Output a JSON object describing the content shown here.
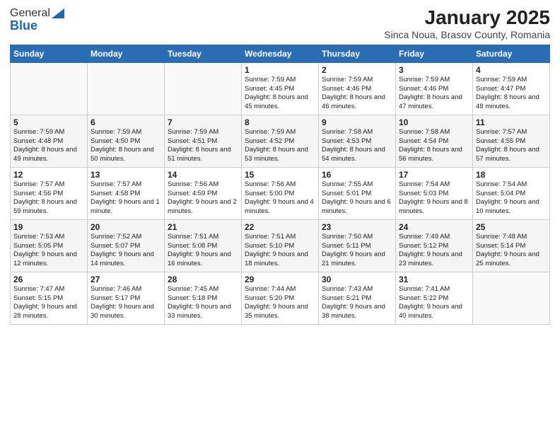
{
  "header": {
    "logo_general": "General",
    "logo_blue": "Blue",
    "title": "January 2025",
    "subtitle": "Sinca Noua, Brasov County, Romania"
  },
  "days_of_week": [
    "Sunday",
    "Monday",
    "Tuesday",
    "Wednesday",
    "Thursday",
    "Friday",
    "Saturday"
  ],
  "weeks": [
    [
      {
        "day": "",
        "info": ""
      },
      {
        "day": "",
        "info": ""
      },
      {
        "day": "",
        "info": ""
      },
      {
        "day": "1",
        "info": "Sunrise: 7:59 AM\nSunset: 4:45 PM\nDaylight: 8 hours and 45 minutes."
      },
      {
        "day": "2",
        "info": "Sunrise: 7:59 AM\nSunset: 4:46 PM\nDaylight: 8 hours and 46 minutes."
      },
      {
        "day": "3",
        "info": "Sunrise: 7:59 AM\nSunset: 4:46 PM\nDaylight: 8 hours and 47 minutes."
      },
      {
        "day": "4",
        "info": "Sunrise: 7:59 AM\nSunset: 4:47 PM\nDaylight: 8 hours and 48 minutes."
      }
    ],
    [
      {
        "day": "5",
        "info": "Sunrise: 7:59 AM\nSunset: 4:48 PM\nDaylight: 8 hours and 49 minutes."
      },
      {
        "day": "6",
        "info": "Sunrise: 7:59 AM\nSunset: 4:50 PM\nDaylight: 8 hours and 50 minutes."
      },
      {
        "day": "7",
        "info": "Sunrise: 7:59 AM\nSunset: 4:51 PM\nDaylight: 8 hours and 51 minutes."
      },
      {
        "day": "8",
        "info": "Sunrise: 7:59 AM\nSunset: 4:52 PM\nDaylight: 8 hours and 53 minutes."
      },
      {
        "day": "9",
        "info": "Sunrise: 7:58 AM\nSunset: 4:53 PM\nDaylight: 8 hours and 54 minutes."
      },
      {
        "day": "10",
        "info": "Sunrise: 7:58 AM\nSunset: 4:54 PM\nDaylight: 8 hours and 56 minutes."
      },
      {
        "day": "11",
        "info": "Sunrise: 7:57 AM\nSunset: 4:55 PM\nDaylight: 8 hours and 57 minutes."
      }
    ],
    [
      {
        "day": "12",
        "info": "Sunrise: 7:57 AM\nSunset: 4:56 PM\nDaylight: 8 hours and 59 minutes."
      },
      {
        "day": "13",
        "info": "Sunrise: 7:57 AM\nSunset: 4:58 PM\nDaylight: 9 hours and 1 minute."
      },
      {
        "day": "14",
        "info": "Sunrise: 7:56 AM\nSunset: 4:59 PM\nDaylight: 9 hours and 2 minutes."
      },
      {
        "day": "15",
        "info": "Sunrise: 7:56 AM\nSunset: 5:00 PM\nDaylight: 9 hours and 4 minutes."
      },
      {
        "day": "16",
        "info": "Sunrise: 7:55 AM\nSunset: 5:01 PM\nDaylight: 9 hours and 6 minutes."
      },
      {
        "day": "17",
        "info": "Sunrise: 7:54 AM\nSunset: 5:03 PM\nDaylight: 9 hours and 8 minutes."
      },
      {
        "day": "18",
        "info": "Sunrise: 7:54 AM\nSunset: 5:04 PM\nDaylight: 9 hours and 10 minutes."
      }
    ],
    [
      {
        "day": "19",
        "info": "Sunrise: 7:53 AM\nSunset: 5:05 PM\nDaylight: 9 hours and 12 minutes."
      },
      {
        "day": "20",
        "info": "Sunrise: 7:52 AM\nSunset: 5:07 PM\nDaylight: 9 hours and 14 minutes."
      },
      {
        "day": "21",
        "info": "Sunrise: 7:51 AM\nSunset: 5:08 PM\nDaylight: 9 hours and 16 minutes."
      },
      {
        "day": "22",
        "info": "Sunrise: 7:51 AM\nSunset: 5:10 PM\nDaylight: 9 hours and 18 minutes."
      },
      {
        "day": "23",
        "info": "Sunrise: 7:50 AM\nSunset: 5:11 PM\nDaylight: 9 hours and 21 minutes."
      },
      {
        "day": "24",
        "info": "Sunrise: 7:49 AM\nSunset: 5:12 PM\nDaylight: 9 hours and 23 minutes."
      },
      {
        "day": "25",
        "info": "Sunrise: 7:48 AM\nSunset: 5:14 PM\nDaylight: 9 hours and 25 minutes."
      }
    ],
    [
      {
        "day": "26",
        "info": "Sunrise: 7:47 AM\nSunset: 5:15 PM\nDaylight: 9 hours and 28 minutes."
      },
      {
        "day": "27",
        "info": "Sunrise: 7:46 AM\nSunset: 5:17 PM\nDaylight: 9 hours and 30 minutes."
      },
      {
        "day": "28",
        "info": "Sunrise: 7:45 AM\nSunset: 5:18 PM\nDaylight: 9 hours and 33 minutes."
      },
      {
        "day": "29",
        "info": "Sunrise: 7:44 AM\nSunset: 5:20 PM\nDaylight: 9 hours and 35 minutes."
      },
      {
        "day": "30",
        "info": "Sunrise: 7:43 AM\nSunset: 5:21 PM\nDaylight: 9 hours and 38 minutes."
      },
      {
        "day": "31",
        "info": "Sunrise: 7:41 AM\nSunset: 5:22 PM\nDaylight: 9 hours and 40 minutes."
      },
      {
        "day": "",
        "info": ""
      }
    ]
  ]
}
